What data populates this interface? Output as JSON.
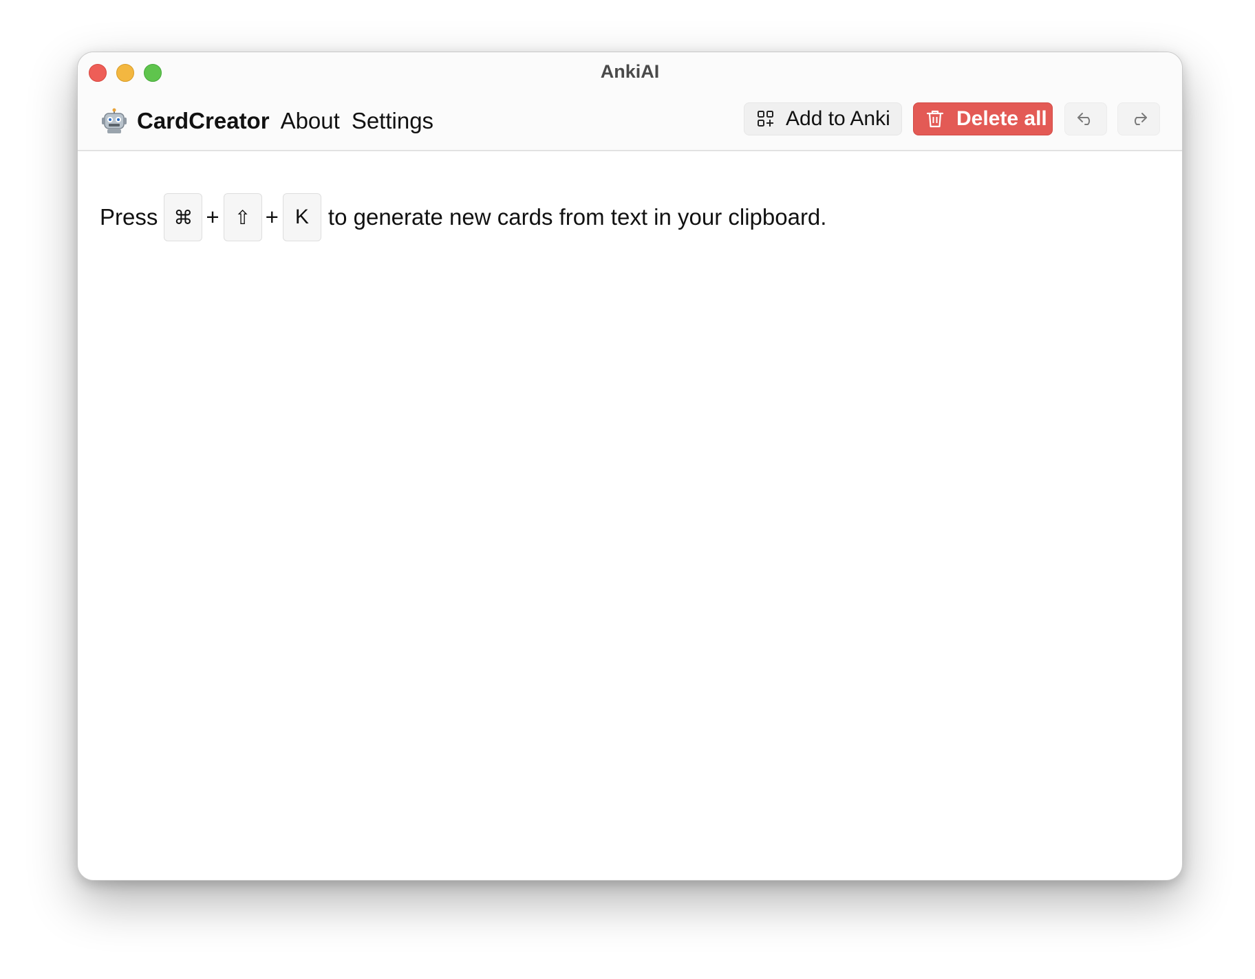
{
  "window": {
    "title": "AnkiAI"
  },
  "nav": {
    "brand": "CardCreator",
    "links": [
      "About",
      "Settings"
    ]
  },
  "toolbar": {
    "add_label": "Add to Anki",
    "delete_label": "Delete all",
    "undo_icon": "undo-arrow-icon",
    "redo_icon": "redo-arrow-icon"
  },
  "hint": {
    "prefix": "Press",
    "keys": [
      "⌘",
      "⇧",
      "K"
    ],
    "separator": "+",
    "suffix": "to generate new cards from text in your clipboard."
  },
  "colors": {
    "delete_button": "#e35a55",
    "close": "#ee5e57",
    "minimize": "#f3b740",
    "maximize": "#5fc44d"
  }
}
